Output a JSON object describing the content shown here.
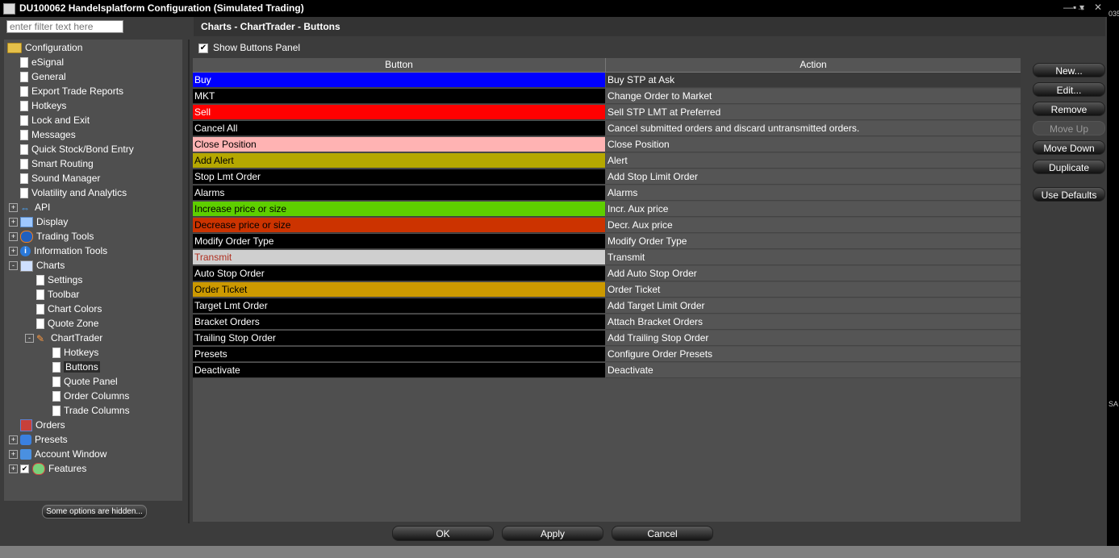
{
  "window": {
    "title": "DU100062 Handelsplatform Configuration (Simulated Trading)",
    "controls": [
      "—▪→",
      "▾",
      "✕"
    ]
  },
  "side_strip": {
    "top_text": "035",
    "mid_text": "SA"
  },
  "filter": {
    "placeholder": "enter filter text here"
  },
  "tree": [
    {
      "label": "Configuration",
      "icon": "folder-icon",
      "level": 0
    },
    {
      "label": "eSignal",
      "icon": "page-icon",
      "level": 1
    },
    {
      "label": "General",
      "icon": "page-icon",
      "level": 1
    },
    {
      "label": "Export Trade Reports",
      "icon": "page-icon",
      "level": 1
    },
    {
      "label": "Hotkeys",
      "icon": "page-icon",
      "level": 1
    },
    {
      "label": "Lock and Exit",
      "icon": "page-icon",
      "level": 1
    },
    {
      "label": "Messages",
      "icon": "page-icon",
      "level": 1
    },
    {
      "label": "Quick Stock/Bond Entry",
      "icon": "page-icon",
      "level": 1
    },
    {
      "label": "Smart Routing",
      "icon": "page-icon",
      "level": 1
    },
    {
      "label": "Sound Manager",
      "icon": "page-icon",
      "level": 1
    },
    {
      "label": "Volatility and Analytics",
      "icon": "page-icon",
      "level": 1
    },
    {
      "label": "API",
      "icon": "api-icon",
      "level": 1,
      "expander": "+"
    },
    {
      "label": "Display",
      "icon": "display-icon",
      "level": 1,
      "expander": "+"
    },
    {
      "label": "Trading Tools",
      "icon": "trading-tools-icon",
      "level": 1,
      "expander": "+"
    },
    {
      "label": "Information Tools",
      "icon": "info-icon",
      "level": 1,
      "expander": "+"
    },
    {
      "label": "Charts",
      "icon": "chart-icon",
      "level": 1,
      "expander": "-"
    },
    {
      "label": "Settings",
      "icon": "page-icon",
      "level": 2
    },
    {
      "label": "Toolbar",
      "icon": "page-icon",
      "level": 2
    },
    {
      "label": "Chart Colors",
      "icon": "page-icon",
      "level": 2
    },
    {
      "label": "Quote Zone",
      "icon": "page-icon",
      "level": 2
    },
    {
      "label": "ChartTrader",
      "icon": "charttrader-icon",
      "level": 2,
      "expander": "-"
    },
    {
      "label": "Hotkeys",
      "icon": "page-icon",
      "level": 3
    },
    {
      "label": "Buttons",
      "icon": "page-icon",
      "level": 3,
      "selected": true
    },
    {
      "label": "Quote Panel",
      "icon": "page-icon",
      "level": 3
    },
    {
      "label": "Order Columns",
      "icon": "page-icon",
      "level": 3
    },
    {
      "label": "Trade Columns",
      "icon": "page-icon",
      "level": 3
    },
    {
      "label": "Orders",
      "icon": "orders-icon",
      "level": 1
    },
    {
      "label": "Presets",
      "icon": "presets-icon",
      "level": 1,
      "expander": "+"
    },
    {
      "label": "Account Window",
      "icon": "account-window-icon",
      "level": 1,
      "expander": "+"
    },
    {
      "label": "Features",
      "icon": "features-icon",
      "level": 1,
      "expander": "+",
      "checkbox": true
    }
  ],
  "hidden_options_label": "Some options are hidden...",
  "panel": {
    "title": "Charts - ChartTrader - Buttons",
    "show_buttons_panel_label": "Show Buttons Panel",
    "show_buttons_panel_checked": "✔"
  },
  "table": {
    "headers": [
      "Button",
      "Action"
    ],
    "rows": [
      {
        "button": "Buy",
        "action": "Buy STP at Ask",
        "bg": "#0000ff",
        "fg": "#ffffff"
      },
      {
        "button": "MKT",
        "action": "Change Order to Market",
        "bg": "#000000",
        "fg": "#ffffff"
      },
      {
        "button": "Sell",
        "action": "Sell STP LMT at Preferred",
        "bg": "#ff0000",
        "fg": "#ffffff"
      },
      {
        "button": "Cancel All",
        "action": "Cancel submitted orders and discard untransmitted orders.",
        "bg": "#000000",
        "fg": "#ffffff"
      },
      {
        "button": "Close Position",
        "action": "Close Position",
        "bg": "#ffb3b3",
        "fg": "#000000"
      },
      {
        "button": "Add Alert",
        "action": "Alert",
        "bg": "#b5a800",
        "fg": "#000000"
      },
      {
        "button": "Stop Lmt Order",
        "action": "Add Stop Limit Order",
        "bg": "#000000",
        "fg": "#ffffff"
      },
      {
        "button": "Alarms",
        "action": "Alarms",
        "bg": "#000000",
        "fg": "#ffffff"
      },
      {
        "button": "Increase price or size",
        "action": "Incr. Aux price",
        "bg": "#5ecf00",
        "fg": "#000000"
      },
      {
        "button": "Decrease price or size",
        "action": "Decr. Aux price",
        "bg": "#cc3300",
        "fg": "#000000"
      },
      {
        "button": "Modify Order Type",
        "action": "Modify Order Type",
        "bg": "#000000",
        "fg": "#ffffff"
      },
      {
        "button": "Transmit",
        "action": "Transmit",
        "bg": "#cfcfcf",
        "fg": "#b03020"
      },
      {
        "button": "Auto Stop Order",
        "action": "Add Auto Stop Order",
        "bg": "#000000",
        "fg": "#ffffff"
      },
      {
        "button": "Order Ticket",
        "action": "Order Ticket",
        "bg": "#cc9900",
        "fg": "#000000"
      },
      {
        "button": "Target Lmt Order",
        "action": "Add Target Limit Order",
        "bg": "#000000",
        "fg": "#ffffff"
      },
      {
        "button": "Bracket Orders",
        "action": "Attach Bracket Orders",
        "bg": "#000000",
        "fg": "#ffffff"
      },
      {
        "button": "Trailing Stop Order",
        "action": "Add Trailing Stop Order",
        "bg": "#000000",
        "fg": "#ffffff"
      },
      {
        "button": "Presets",
        "action": "Configure Order Presets",
        "bg": "#000000",
        "fg": "#ffffff"
      },
      {
        "button": "Deactivate",
        "action": "Deactivate",
        "bg": "#000000",
        "fg": "#ffffff"
      }
    ]
  },
  "side_buttons": [
    {
      "label": "New...",
      "enabled": true
    },
    {
      "label": "Edit...",
      "enabled": true
    },
    {
      "label": "Remove",
      "enabled": true
    },
    {
      "label": "Move Up",
      "enabled": false
    },
    {
      "label": "Move Down",
      "enabled": true
    },
    {
      "label": "Duplicate",
      "enabled": true
    },
    {
      "label": "Use Defaults",
      "enabled": true
    }
  ],
  "footer": {
    "ok": "OK",
    "apply": "Apply",
    "cancel": "Cancel"
  }
}
